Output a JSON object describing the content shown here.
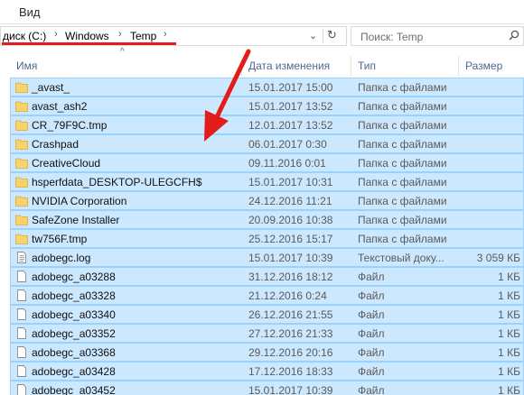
{
  "menu": {
    "view_label": "Вид"
  },
  "address_bar": {
    "crumbs": [
      "диск (C:)",
      "Windows",
      "Temp"
    ],
    "dropdown_icon": "chevron-down-icon",
    "refresh_icon": "refresh-icon"
  },
  "search": {
    "placeholder": "Поиск: Temp",
    "icon": "search-icon"
  },
  "columns": {
    "name": "Имя",
    "date": "Дата изменения",
    "type": "Тип",
    "size": "Размер"
  },
  "colors": {
    "selection_bg": "#cce8ff",
    "selection_border": "#99d1ff",
    "annotation_red": "#e21b1b",
    "folder": "#f8d26a"
  },
  "files": [
    {
      "name": "_avast_",
      "date": "15.01.2017 15:00",
      "type": "Папка с файлами",
      "size": "",
      "icon": "folder-icon"
    },
    {
      "name": "avast_ash2",
      "date": "15.01.2017 13:52",
      "type": "Папка с файлами",
      "size": "",
      "icon": "folder-icon"
    },
    {
      "name": "CR_79F9C.tmp",
      "date": "12.01.2017 13:52",
      "type": "Папка с файлами",
      "size": "",
      "icon": "folder-icon"
    },
    {
      "name": "Crashpad",
      "date": "06.01.2017 0:30",
      "type": "Папка с файлами",
      "size": "",
      "icon": "folder-icon"
    },
    {
      "name": "CreativeCloud",
      "date": "09.11.2016 0:01",
      "type": "Папка с файлами",
      "size": "",
      "icon": "folder-icon"
    },
    {
      "name": "hsperfdata_DESKTOP-ULEGCFH$",
      "date": "15.01.2017 10:31",
      "type": "Папка с файлами",
      "size": "",
      "icon": "folder-icon"
    },
    {
      "name": "NVIDIA Corporation",
      "date": "24.12.2016 11:21",
      "type": "Папка с файлами",
      "size": "",
      "icon": "folder-icon"
    },
    {
      "name": "SafeZone Installer",
      "date": "20.09.2016 10:38",
      "type": "Папка с файлами",
      "size": "",
      "icon": "folder-icon"
    },
    {
      "name": "tw756F.tmp",
      "date": "25.12.2016 15:17",
      "type": "Папка с файлами",
      "size": "",
      "icon": "folder-icon"
    },
    {
      "name": "adobegc.log",
      "date": "15.01.2017 10:39",
      "type": "Текстовый доку...",
      "size": "3 059 КБ",
      "icon": "text-file-icon"
    },
    {
      "name": "adobegc_a03288",
      "date": "31.12.2016 18:12",
      "type": "Файл",
      "size": "1 КБ",
      "icon": "file-icon"
    },
    {
      "name": "adobegc_a03328",
      "date": "21.12.2016 0:24",
      "type": "Файл",
      "size": "1 КБ",
      "icon": "file-icon"
    },
    {
      "name": "adobegc_a03340",
      "date": "26.12.2016 21:55",
      "type": "Файл",
      "size": "1 КБ",
      "icon": "file-icon"
    },
    {
      "name": "adobegc_a03352",
      "date": "27.12.2016 21:33",
      "type": "Файл",
      "size": "1 КБ",
      "icon": "file-icon"
    },
    {
      "name": "adobegc_a03368",
      "date": "29.12.2016 20:16",
      "type": "Файл",
      "size": "1 КБ",
      "icon": "file-icon"
    },
    {
      "name": "adobegc_a03428",
      "date": "17.12.2016 18:33",
      "type": "Файл",
      "size": "1 КБ",
      "icon": "file-icon"
    },
    {
      "name": "adobegc_a03452",
      "date": "15.01.2017 10:39",
      "type": "Файл",
      "size": "1 КБ",
      "icon": "file-icon"
    }
  ]
}
